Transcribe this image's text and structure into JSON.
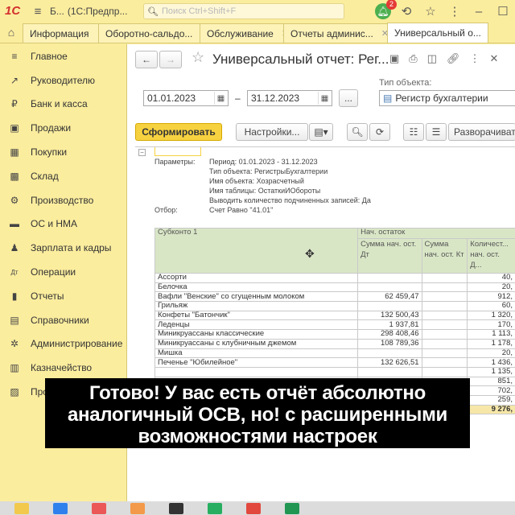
{
  "titlebar": {
    "logo": "1С",
    "title_short": "Б...",
    "title_app": "(1С:Предпр...",
    "search_placeholder": "Поиск Ctrl+Shift+F",
    "notifications_count": "2"
  },
  "tabs": [
    {
      "label": "Информация"
    },
    {
      "label": "Оборотно-сальдо..."
    },
    {
      "label": "Обслуживание"
    },
    {
      "label": "Отчеты админис..."
    },
    {
      "label": "Универсальный о..."
    }
  ],
  "sidebar": {
    "items": [
      {
        "label": "Главное",
        "icon": "≡"
      },
      {
        "label": "Руководителю",
        "icon": "↗"
      },
      {
        "label": "Банк и касса",
        "icon": "₽"
      },
      {
        "label": "Продажи",
        "icon": "▣"
      },
      {
        "label": "Покупки",
        "icon": "▦"
      },
      {
        "label": "Склад",
        "icon": "▩"
      },
      {
        "label": "Производство",
        "icon": "⚙"
      },
      {
        "label": "ОС и НМА",
        "icon": "▬"
      },
      {
        "label": "Зарплата и кадры",
        "icon": "♟"
      },
      {
        "label": "Операции",
        "icon": "Дт"
      },
      {
        "label": "Отчеты",
        "icon": "▮"
      },
      {
        "label": "Справочники",
        "icon": "▤"
      },
      {
        "label": "Администрирование",
        "icon": "✲"
      },
      {
        "label": "Казначейство",
        "icon": "▥"
      },
      {
        "label": "Про...",
        "icon": "▨"
      }
    ]
  },
  "report_form": {
    "title": "Универсальный отчет: Рег...",
    "date_from": "01.01.2023",
    "date_sep": "–",
    "date_to": "31.12.2023",
    "dots": "...",
    "object_type_label": "Тип объекта:",
    "object_type_value": "Регистр бухгалтерии",
    "generate_button": "Сформировать",
    "settings_button": "Настройки...",
    "expand_button": "Разворачивать"
  },
  "params": [
    {
      "key": "Параметры:",
      "value": "Период: 01.01.2023 - 31.12.2023"
    },
    {
      "key": "",
      "value": "Тип объекта: РегистрыБухгалтерии"
    },
    {
      "key": "",
      "value": "Имя объекта: Хозрасчетный"
    },
    {
      "key": "",
      "value": "Имя таблицы: ОстаткиИОбороты"
    },
    {
      "key": "",
      "value": "Выводить количество подчиненных записей: Да"
    },
    {
      "key": "Отбор:",
      "value": "Счет Равно \"41.01\""
    }
  ],
  "table": {
    "col_subkonto": "Субконто 1",
    "col_group": "Нач. остаток",
    "col_dt": "Сумма нач. ост. Дт",
    "col_kt": "Сумма нач. ост. Кт",
    "col_qty": "Количест... нач. ост. Д...",
    "rows": [
      {
        "name": "Ассорти",
        "dt": "",
        "kt": "",
        "qty": "40,"
      },
      {
        "name": "Белочка",
        "dt": "",
        "kt": "",
        "qty": "20,"
      },
      {
        "name": "Вафли \"Венские\" со сгущенным молоком",
        "dt": "62 459,47",
        "kt": "",
        "qty": "912,"
      },
      {
        "name": "Грильяж",
        "dt": "",
        "kt": "",
        "qty": "60,"
      },
      {
        "name": "Конфеты \"Батончик\"",
        "dt": "132 500,43",
        "kt": "",
        "qty": "1 320,"
      },
      {
        "name": "Леденцы",
        "dt": "1 937,81",
        "kt": "",
        "qty": "170,"
      },
      {
        "name": "Миникруассаны классические",
        "dt": "298 408,46",
        "kt": "",
        "qty": "1 113,"
      },
      {
        "name": "Миникруассаны с клубничным джемом",
        "dt": "108 789,36",
        "kt": "",
        "qty": "1 178,"
      },
      {
        "name": "Мишка",
        "dt": "",
        "kt": "",
        "qty": "20,"
      },
      {
        "name": "Печенье \"Юбилейное\"",
        "dt": "132 626,51",
        "kt": "",
        "qty": "1 436,"
      },
      {
        "name": "",
        "dt": "",
        "kt": "",
        "qty": "1 135,"
      },
      {
        "name": "",
        "dt": "",
        "kt": "",
        "qty": "851,"
      },
      {
        "name": "",
        "dt": "",
        "kt": "",
        "qty": "702,"
      },
      {
        "name": "",
        "dt": "",
        "kt": "",
        "qty": "259,"
      }
    ],
    "total_qty": "9 276,"
  },
  "overlay_lines": [
    "Готово! У вас есть отчёт абсолютно",
    "аналогичный ОСВ, но! с расширенными",
    "возможностями настроек"
  ],
  "colors": {
    "panel": "#fbed9e",
    "accent_button": "#f7d240",
    "table_header": "#d9e6c6"
  }
}
